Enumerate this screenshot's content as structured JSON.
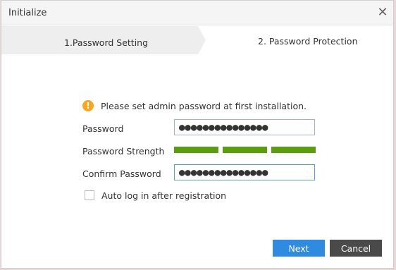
{
  "window": {
    "title": "Initialize",
    "close_icon": "close-icon"
  },
  "steps": [
    {
      "label": "1.Password Setting",
      "active": true
    },
    {
      "label": "2. Password Protection",
      "active": false
    }
  ],
  "notice": {
    "icon": "warning-icon",
    "text": "Please set admin password at first installation."
  },
  "form": {
    "password_label": "Password",
    "password_value": "●●●●●●●●●●●●●●●",
    "strength_label": "Password Strength",
    "strength_level": 3,
    "strength_max": 3,
    "strength_color": "#5a9e0f",
    "confirm_label": "Confirm Password",
    "confirm_value": "●●●●●●●●●●●●●●●",
    "autologin_label": "Auto log in after registration",
    "autologin_checked": false
  },
  "buttons": {
    "next": "Next",
    "cancel": "Cancel"
  },
  "colors": {
    "primary": "#2f8be0",
    "secondary": "#4a4a4a",
    "warning": "#f5a623"
  }
}
